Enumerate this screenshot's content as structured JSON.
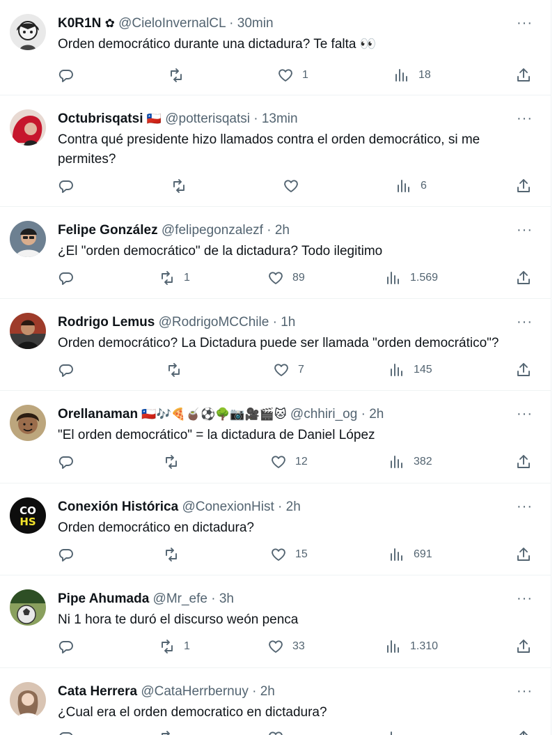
{
  "more_label": "···",
  "tweets": [
    {
      "name": "K0R1N",
      "badge": "✿",
      "handle": "@CieloInvernalCL",
      "dot": "·",
      "time": "30min",
      "text": "Orden democrático durante una dictadura? Te falta 👀",
      "replies": "",
      "retweets": "",
      "likes": "1",
      "views": "18"
    },
    {
      "name": "Octubrisqatsi",
      "badge": "🇨🇱",
      "handle": "@potterisqatsi",
      "dot": "·",
      "time": "13min",
      "text": "Contra qué presidente hizo llamados contra el orden democrático, si me permites?",
      "replies": "",
      "retweets": "",
      "likes": "",
      "views": "6"
    },
    {
      "name": "Felipe González",
      "badge": "",
      "handle": "@felipegonzalezf",
      "dot": "·",
      "time": "2h",
      "text": "¿El \"orden democrático\" de la dictadura? Todo ilegitimo",
      "replies": "",
      "retweets": "1",
      "likes": "89",
      "views": "1.569"
    },
    {
      "name": "Rodrigo Lemus",
      "badge": "",
      "handle": "@RodrigoMCChile",
      "dot": "·",
      "time": "1h",
      "text": "Orden democrático? La Dictadura puede ser llamada \"orden democrático\"?",
      "replies": "",
      "retweets": "",
      "likes": "7",
      "views": "145"
    },
    {
      "name": "Orellanaman",
      "badge": "🇨🇱🎶🍕🧉⚽🌳📷🎥🎬🐱",
      "handle": "@chhiri_og",
      "dot": "·",
      "time": "2h",
      "text": "\"El orden democrático\" = la dictadura de Daniel López",
      "replies": "",
      "retweets": "",
      "likes": "12",
      "views": "382"
    },
    {
      "name": "Conexión Histórica",
      "badge": "",
      "handle": "@ConexionHist",
      "dot": "·",
      "time": "2h",
      "text": "Orden democrático en dictadura?",
      "replies": "",
      "retweets": "",
      "likes": "15",
      "views": "691"
    },
    {
      "name": "Pipe Ahumada",
      "badge": "",
      "handle": "@Mr_efe",
      "dot": "·",
      "time": "3h",
      "text": "Ni 1 hora te duró el discurso weón penca",
      "replies": "",
      "retweets": "1",
      "likes": "33",
      "views": "1.310"
    },
    {
      "name": "Cata Herrera",
      "badge": "",
      "handle": "@CataHerrbernuy",
      "dot": "·",
      "time": "2h",
      "text": "¿Cual era el orden democratico en dictadura?",
      "replies": "",
      "retweets": "",
      "likes": "",
      "views": ""
    }
  ],
  "avatar_logo_text": "CO HS",
  "icon_names": [
    "reply-icon",
    "retweet-icon",
    "like-icon",
    "views-icon",
    "share-icon",
    "more-icon"
  ],
  "colors": {
    "text": "#0f1419",
    "muted": "#536471",
    "divider": "#eff3f4"
  }
}
